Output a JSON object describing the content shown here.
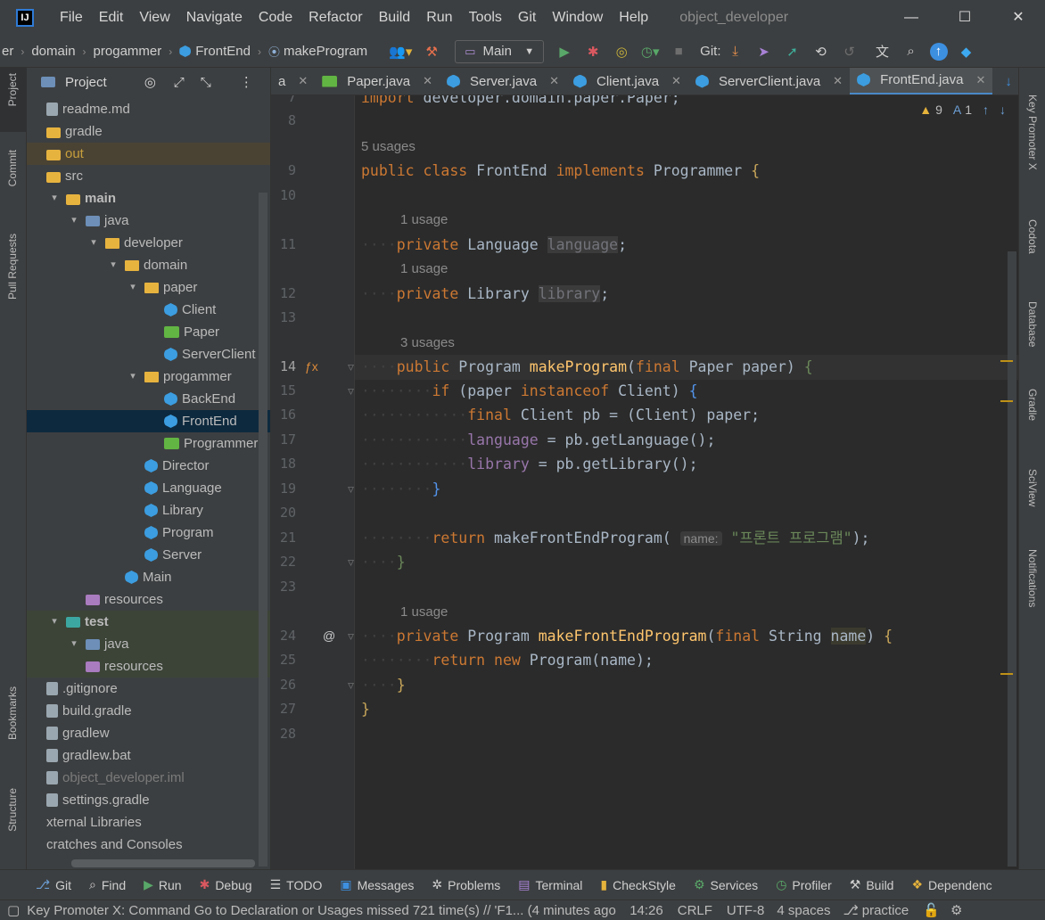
{
  "menu": [
    "File",
    "Edit",
    "View",
    "Navigate",
    "Code",
    "Refactor",
    "Build",
    "Run",
    "Tools",
    "Git",
    "Window",
    "Help"
  ],
  "project_title": "object_developer",
  "window_controls": {
    "minimize": "—",
    "maximize": "☐",
    "close": "✕"
  },
  "breadcrumb": {
    "items": [
      "er",
      "domain",
      "progammer",
      "FrontEnd",
      "makeProgram"
    ]
  },
  "run_config": "Main",
  "git_label": "Git:",
  "left_stripe": {
    "project": "Project",
    "commit": "Commit",
    "pull_requests": "Pull Requests",
    "bookmarks": "Bookmarks",
    "structure": "Structure"
  },
  "right_stripe": {
    "key_promoter": "Key Promoter X",
    "codota": "Codota",
    "database": "Database",
    "gradle": "Gradle",
    "sciview": "SciView",
    "notifications": "Notifications"
  },
  "project_panel": {
    "title": "Project"
  },
  "tree": [
    {
      "label": "readme.md",
      "indent": 0,
      "chev": "",
      "icon": "file"
    },
    {
      "label": "gradle",
      "indent": 0,
      "chev": "",
      "icon": "folder"
    },
    {
      "label": "out",
      "indent": 0,
      "chev": "",
      "icon": "folder"
    },
    {
      "label": "src",
      "indent": 0,
      "chev": "",
      "icon": "folder"
    },
    {
      "label": "main",
      "indent": 1,
      "chev": "▾",
      "icon": "folder"
    },
    {
      "label": "java",
      "indent": 2,
      "chev": "▾",
      "icon": "srcfolder"
    },
    {
      "label": "developer",
      "indent": 3,
      "chev": "▾",
      "icon": "pkg"
    },
    {
      "label": "domain",
      "indent": 4,
      "chev": "▾",
      "icon": "pkg"
    },
    {
      "label": "paper",
      "indent": 5,
      "chev": "▾",
      "icon": "pkg"
    },
    {
      "label": "Client",
      "indent": 6,
      "chev": "",
      "icon": "class"
    },
    {
      "label": "Paper",
      "indent": 6,
      "chev": "",
      "icon": "iface"
    },
    {
      "label": "ServerClient",
      "indent": 6,
      "chev": "",
      "icon": "class"
    },
    {
      "label": "progammer",
      "indent": 5,
      "chev": "▾",
      "icon": "pkg"
    },
    {
      "label": "BackEnd",
      "indent": 6,
      "chev": "",
      "icon": "class"
    },
    {
      "label": "FrontEnd",
      "indent": 6,
      "chev": "",
      "icon": "class"
    },
    {
      "label": "Programmer",
      "indent": 6,
      "chev": "",
      "icon": "iface"
    },
    {
      "label": "Director",
      "indent": 5,
      "chev": "",
      "icon": "class"
    },
    {
      "label": "Language",
      "indent": 5,
      "chev": "",
      "icon": "class"
    },
    {
      "label": "Library",
      "indent": 5,
      "chev": "",
      "icon": "class"
    },
    {
      "label": "Program",
      "indent": 5,
      "chev": "",
      "icon": "class"
    },
    {
      "label": "Server",
      "indent": 5,
      "chev": "",
      "icon": "class"
    },
    {
      "label": "Main",
      "indent": 4,
      "chev": "",
      "icon": "class"
    },
    {
      "label": "resources",
      "indent": 2,
      "chev": "",
      "icon": "res"
    },
    {
      "label": "test",
      "indent": 1,
      "chev": "▾",
      "icon": "test"
    },
    {
      "label": "java",
      "indent": 2,
      "chev": "▾",
      "icon": "srcfolder"
    },
    {
      "label": "resources",
      "indent": 2,
      "chev": "",
      "icon": "res"
    },
    {
      "label": ".gitignore",
      "indent": 0,
      "chev": "",
      "icon": "file"
    },
    {
      "label": "build.gradle",
      "indent": 0,
      "chev": "",
      "icon": "file"
    },
    {
      "label": "gradlew",
      "indent": 0,
      "chev": "",
      "icon": "file"
    },
    {
      "label": "gradlew.bat",
      "indent": 0,
      "chev": "",
      "icon": "file"
    },
    {
      "label": "object_developer.iml",
      "indent": 0,
      "chev": "",
      "icon": "file"
    },
    {
      "label": "settings.gradle",
      "indent": 0,
      "chev": "",
      "icon": "file"
    },
    {
      "label": "xternal Libraries",
      "indent": 0,
      "chev": "",
      "icon": ""
    },
    {
      "label": "cratches and Consoles",
      "indent": 0,
      "chev": "",
      "icon": ""
    }
  ],
  "tabs": [
    {
      "label": "a"
    },
    {
      "label": "Paper.java"
    },
    {
      "label": "Server.java"
    },
    {
      "label": "Client.java"
    },
    {
      "label": "ServerClient.java"
    },
    {
      "label": "FrontEnd.java"
    }
  ],
  "inspections": {
    "warnings": "9",
    "typos": "1"
  },
  "editor": {
    "lines": [
      {
        "n": "7",
        "html": "<span class='kw'>import</span> developer.domain.paper.Paper;"
      },
      {
        "n": "8",
        "html": ""
      },
      {
        "n": "9",
        "html": "<span class='kw'>public class</span> FrontEnd <span class='kw'>implements</span> Programmer <span class='fn' style='color:#c8a65a'>{</span>"
      },
      {
        "n": "10",
        "html": ""
      },
      {
        "n": "11",
        "html": "<span class='dot'>····</span><span class='kw'>private</span> Language <span class='unused'>language</span>;"
      },
      {
        "n": "12",
        "html": "<span class='dot'>····</span><span class='kw'>private</span> Library <span class='unused'>library</span>;"
      },
      {
        "n": "13",
        "html": ""
      },
      {
        "n": "14",
        "html": "<span class='dot'>····</span><span class='kw'>public</span> Program <span class='fn'>makeProgram</span>(<span class='kw'>final</span> Paper paper) <span style='color:#6a8759'>{</span>"
      },
      {
        "n": "15",
        "html": "<span class='dot'>········</span><span class='kw'>if</span> (paper <span class='kw'>instanceof</span> Client) <span style='color:#5394ec'>{</span>"
      },
      {
        "n": "16",
        "html": "<span class='dot'>············</span><span class='kw'>final</span> Client pb = (Client) paper;"
      },
      {
        "n": "17",
        "html": "<span class='dot'>············</span><span class='fld'>language</span> = pb.getLanguage();"
      },
      {
        "n": "18",
        "html": "<span class='dot'>············</span><span class='fld'>library</span> = pb.getLibrary();"
      },
      {
        "n": "19",
        "html": "<span class='dot'>········</span><span style='color:#5394ec'>}</span>"
      },
      {
        "n": "20",
        "html": ""
      },
      {
        "n": "21",
        "html": "<span class='dot'>········</span><span class='kw'>return</span> makeFrontEndProgram( <span class='inhint'>name:</span> <span class='str'>\"프론트 프로그램\"</span>);"
      },
      {
        "n": "22",
        "html": "<span class='dot'>····</span><span style='color:#6a8759'>}</span>"
      },
      {
        "n": "23",
        "html": ""
      },
      {
        "n": "24",
        "html": "<span class='dot'>····</span><span class='kw'>private</span> Program <span class='fn'>makeFrontEndProgram</span>(<span class='kw'>final</span> String <span style='background:#3b3a2e'>name</span>) <span style='color:#c8a65a'>{</span>"
      },
      {
        "n": "25",
        "html": "<span class='dot'>········</span><span class='kw'>return new</span> Program(name);"
      },
      {
        "n": "26",
        "html": "<span class='dot'>····</span><span style='color:#c8a65a'>}</span>"
      },
      {
        "n": "27",
        "html": "<span style='color:#c8a65a'>}</span>"
      },
      {
        "n": "28",
        "html": ""
      }
    ],
    "hints": [
      "5 usages",
      "1 usage",
      "1 usage",
      "3 usages",
      "1 usage"
    ]
  },
  "bottom_tools": [
    "Git",
    "Find",
    "Run",
    "Debug",
    "TODO",
    "Messages",
    "Problems",
    "Terminal",
    "CheckStyle",
    "Services",
    "Profiler",
    "Build",
    "Dependenc"
  ],
  "status": {
    "message": "Key Promoter X: Command Go to Declaration or Usages missed 721 time(s) // 'F1... (4 minutes ago",
    "position": "14:26",
    "line_sep": "CRLF",
    "encoding": "UTF-8",
    "indent": "4 spaces",
    "branch": "practice"
  },
  "colors": {
    "accent": "#4a88c7",
    "selection": "#0d293e",
    "keyword": "#cc7832",
    "function": "#ffc66d",
    "string": "#6a8759",
    "field": "#9876aa"
  }
}
